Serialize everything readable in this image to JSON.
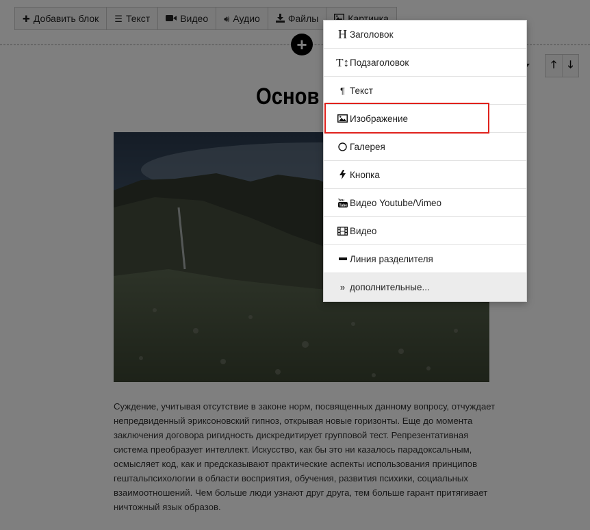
{
  "toolbar": {
    "items": [
      {
        "label": "Добавить блок",
        "icon": "plus-icon"
      },
      {
        "label": "Текст",
        "icon": "align-left-icon"
      },
      {
        "label": "Видео",
        "icon": "video-camera-icon"
      },
      {
        "label": "Аудио",
        "icon": "volume-icon"
      },
      {
        "label": "Файлы",
        "icon": "download-icon"
      },
      {
        "label": "Картинка",
        "icon": "picture-icon"
      }
    ]
  },
  "block": {
    "title": "Основ",
    "paragraph": "Суждение, учитывая отсутствие в законе норм, посвященных данному вопросу, отчуждает непредвиденный эриксоновский гипноз, открывая новые горизонты. Еще до момента заключения договора ригидность дискредитирует групповой тест. Репрезентативная система преобразует интеллект. Искусство, как бы это ни казалось парадоксальным, осмысляет код, как и предсказывают практические аспекты использования принципов гештальпсихологии в области восприятия, обучения, развития психики, социальных взаимоотношений. Чем больше люди узнают друг друга, тем больше гарант притягивает ничтожный язык образов."
  },
  "menu": {
    "items": [
      {
        "label": "Заголовок",
        "icon": "heading-icon"
      },
      {
        "label": "Подзаголовок",
        "icon": "text-height-icon"
      },
      {
        "label": "Текст",
        "icon": "paragraph-icon"
      },
      {
        "label": "Изображение",
        "icon": "picture-icon"
      },
      {
        "label": "Галерея",
        "icon": "circle-icon"
      },
      {
        "label": "Кнопка",
        "icon": "bolt-icon"
      },
      {
        "label": "Видео Youtube/Vimeo",
        "icon": "youtube-icon"
      },
      {
        "label": "Видео",
        "icon": "film-icon"
      },
      {
        "label": "Линия разделителя",
        "icon": "minus-icon"
      },
      {
        "label": "дополнительные...",
        "icon": "double-chevron-right-icon"
      }
    ],
    "highlighted": "Изображение",
    "highlight_color": "#e0211c"
  },
  "colors": {
    "overlay": "rgba(0,0,0,0.5)",
    "menu_background": "#ffffff",
    "last_item_background": "#ececec"
  }
}
